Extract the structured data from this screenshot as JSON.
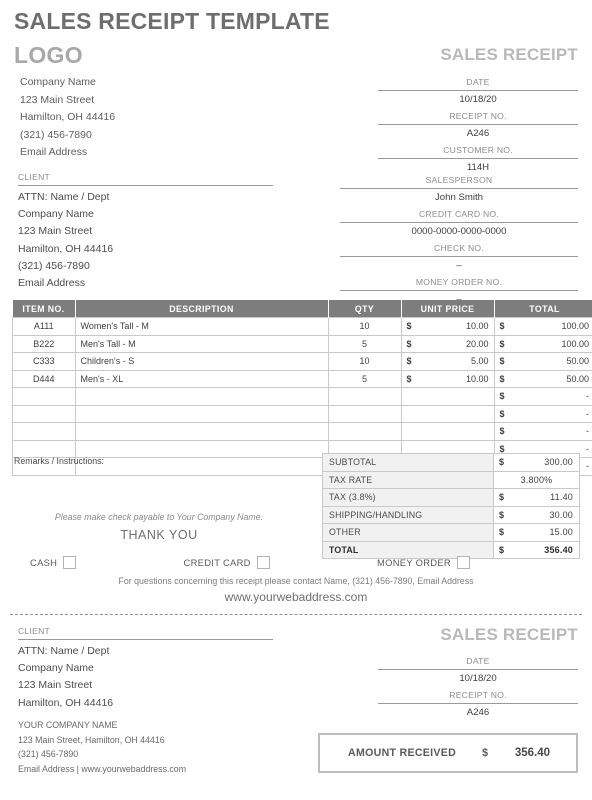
{
  "header": {
    "title": "SALES RECEIPT TEMPLATE",
    "logo": "LOGO",
    "doc_heading": "SALES RECEIPT"
  },
  "company": {
    "lines": [
      "Company Name",
      "123 Main Street",
      "Hamilton, OH  44416",
      "(321) 456-7890",
      "Email Address"
    ]
  },
  "receipt_info": [
    {
      "label": "DATE",
      "value": "10/18/20"
    },
    {
      "label": "RECEIPT NO.",
      "value": "A246"
    },
    {
      "label": "CUSTOMER NO.",
      "value": "114H"
    }
  ],
  "client": {
    "caption": "CLIENT",
    "lines": [
      "ATTN: Name / Dept",
      "Company Name",
      "123 Main Street",
      "Hamilton, OH  44416",
      "(321) 456-7890",
      "Email Address"
    ]
  },
  "payment_info": [
    {
      "label": "SALESPERSON",
      "value": "John Smith"
    },
    {
      "label": "CREDIT CARD NO.",
      "value": "0000-0000-0000-0000"
    },
    {
      "label": "CHECK NO.",
      "value": "–"
    },
    {
      "label": "MONEY ORDER NO.",
      "value": "–"
    }
  ],
  "items_table": {
    "columns": [
      "ITEM NO.",
      "DESCRIPTION",
      "QTY",
      "UNIT PRICE",
      "TOTAL"
    ],
    "currency_symbol": "$",
    "rows": [
      {
        "item_no": "A111",
        "description": "Women's Tall - M",
        "qty": "10",
        "unit_price": "10.00",
        "total": "100.00"
      },
      {
        "item_no": "B222",
        "description": "Men's Tall - M",
        "qty": "5",
        "unit_price": "20.00",
        "total": "100.00"
      },
      {
        "item_no": "C333",
        "description": "Children's - S",
        "qty": "10",
        "unit_price": "5.00",
        "total": "50.00"
      },
      {
        "item_no": "D444",
        "description": "Men's - XL",
        "qty": "5",
        "unit_price": "10.00",
        "total": "50.00"
      },
      {
        "item_no": "",
        "description": "",
        "qty": "",
        "unit_price": "",
        "total": "-"
      },
      {
        "item_no": "",
        "description": "",
        "qty": "",
        "unit_price": "",
        "total": "-"
      },
      {
        "item_no": "",
        "description": "",
        "qty": "",
        "unit_price": "",
        "total": "-"
      },
      {
        "item_no": "",
        "description": "",
        "qty": "",
        "unit_price": "",
        "total": "-"
      },
      {
        "item_no": "",
        "description": "",
        "qty": "",
        "unit_price": "",
        "total": "-"
      }
    ]
  },
  "totals": [
    {
      "label": "SUBTOTAL",
      "currency": "$",
      "value": "300.00",
      "centered": false
    },
    {
      "label": "TAX RATE",
      "currency": "",
      "value": "3.800%",
      "centered": true
    },
    {
      "label": "TAX (3.8%)",
      "currency": "$",
      "value": "11.40",
      "centered": false
    },
    {
      "label": "SHIPPING/HANDLING",
      "currency": "$",
      "value": "30.00",
      "centered": false
    },
    {
      "label": "OTHER",
      "currency": "$",
      "value": "15.00",
      "centered": false
    },
    {
      "label": "TOTAL",
      "currency": "$",
      "value": "356.40",
      "centered": false
    }
  ],
  "remarks": {
    "label": "Remarks / Instructions:",
    "payable_note": "Please make check payable to  Your Company Name.",
    "thank_you": "THANK YOU"
  },
  "payment_methods": [
    {
      "label": "CASH"
    },
    {
      "label": "CREDIT CARD"
    },
    {
      "label": "MONEY ORDER"
    }
  ],
  "footer": {
    "contact": "For questions concerning this receipt please contact Name, (321) 456-7890, Email Address",
    "website": "www.yourwebaddress.com"
  },
  "stub": {
    "doc_heading": "SALES RECEIPT",
    "client_caption": "CLIENT",
    "client_lines": [
      "ATTN: Name / Dept",
      "Company Name",
      "123 Main Street",
      "Hamilton, OH  44416"
    ],
    "info": [
      {
        "label": "DATE",
        "value": "10/18/20"
      },
      {
        "label": "RECEIPT NO.",
        "value": "A246"
      }
    ],
    "company_lines": [
      "YOUR COMPANY NAME",
      "123 Main Street, Hamilton, OH  44416",
      "(321) 456-7890",
      "Email Address | www.yourwebaddress.com"
    ],
    "amount_received_label": "AMOUNT RECEIVED",
    "amount_received_currency": "$",
    "amount_received_value": "356.40"
  },
  "colors": {
    "title_gray": "#6e6e6e",
    "logo_gray": "#a8a8a8",
    "heading_gray": "#b9b9b9",
    "table_header_bg": "#7d7d7d",
    "totals_label_bg": "#f1f1f1",
    "border_gray": "#c9c9c9"
  }
}
